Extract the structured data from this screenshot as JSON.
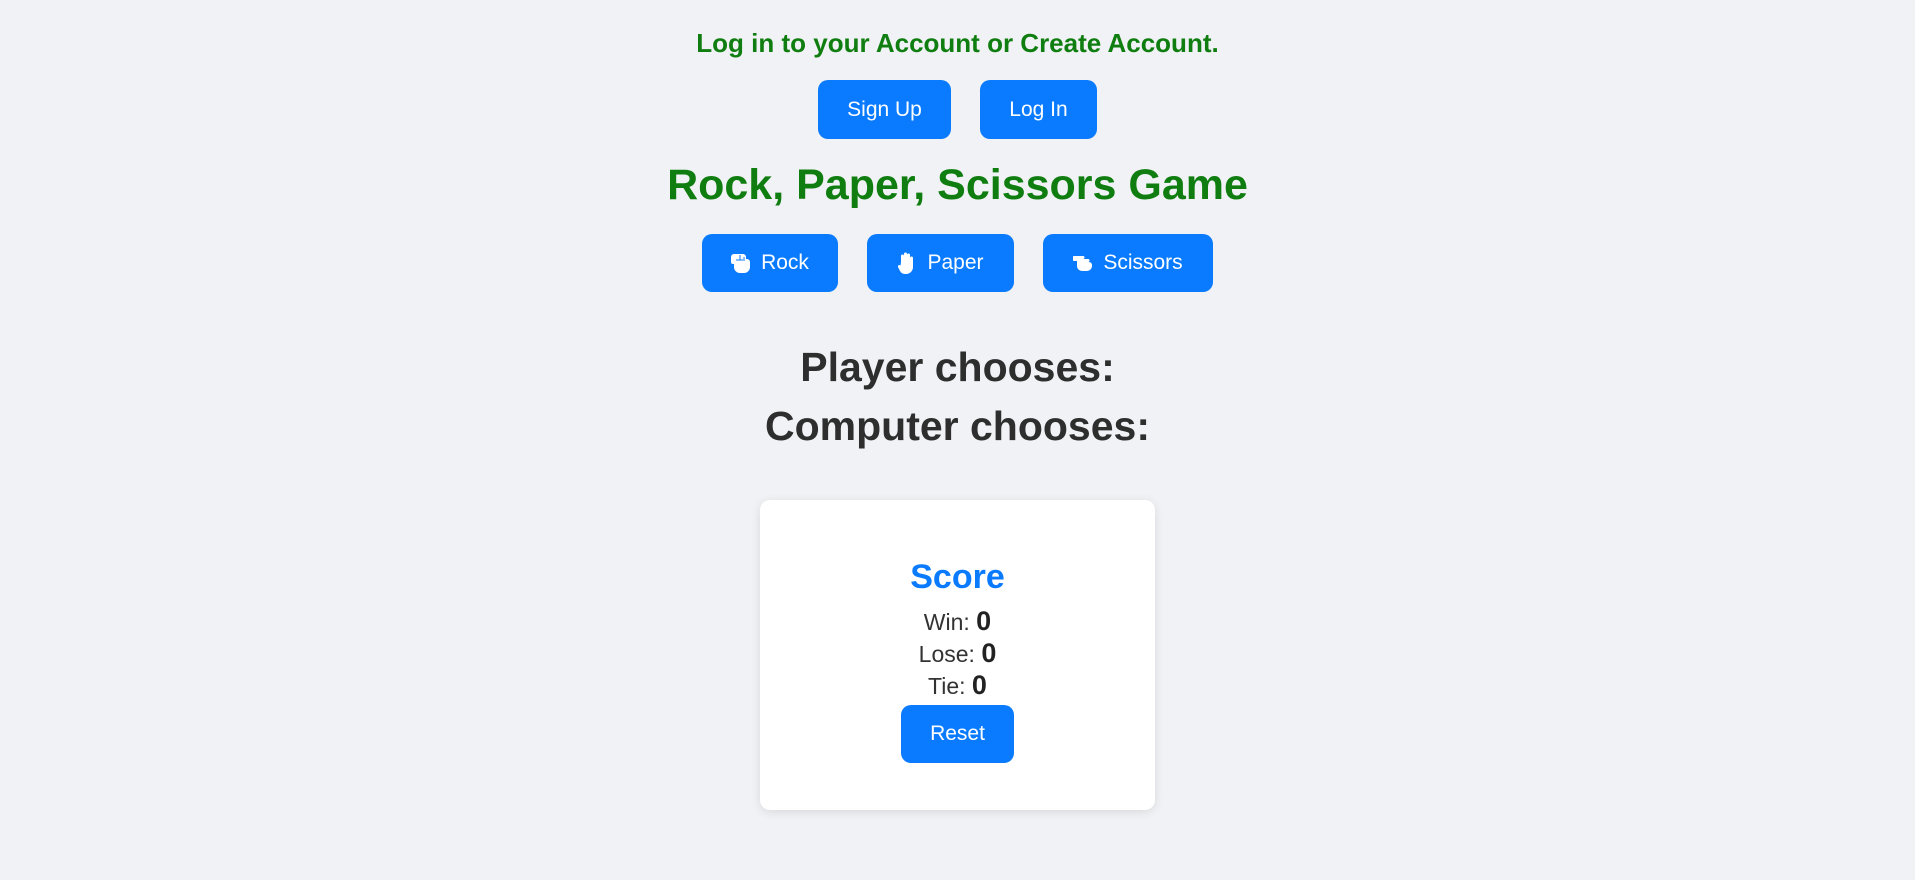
{
  "auth": {
    "message": "Log in to your Account or Create Account.",
    "signup_label": "Sign Up",
    "login_label": "Log In"
  },
  "game": {
    "title": "Rock, Paper, Scissors Game",
    "choices": {
      "rock": {
        "label": "Rock",
        "icon": "fist-icon"
      },
      "paper": {
        "label": "Paper",
        "icon": "open-hand-icon"
      },
      "scissors": {
        "label": "Scissors",
        "icon": "scissors-hand-icon"
      }
    },
    "player_label": "Player chooses:",
    "computer_label": "Computer chooses:"
  },
  "score": {
    "title": "Score",
    "win_label": "Win:",
    "win_value": "0",
    "lose_label": "Lose:",
    "lose_value": "0",
    "tie_label": "Tie:",
    "tie_value": "0",
    "reset_label": "Reset"
  },
  "colors": {
    "background": "#f0f2f5",
    "accent_blue": "#0a7bff",
    "heading_green": "#0f7d0f",
    "text_dark": "#2e2e2e"
  }
}
